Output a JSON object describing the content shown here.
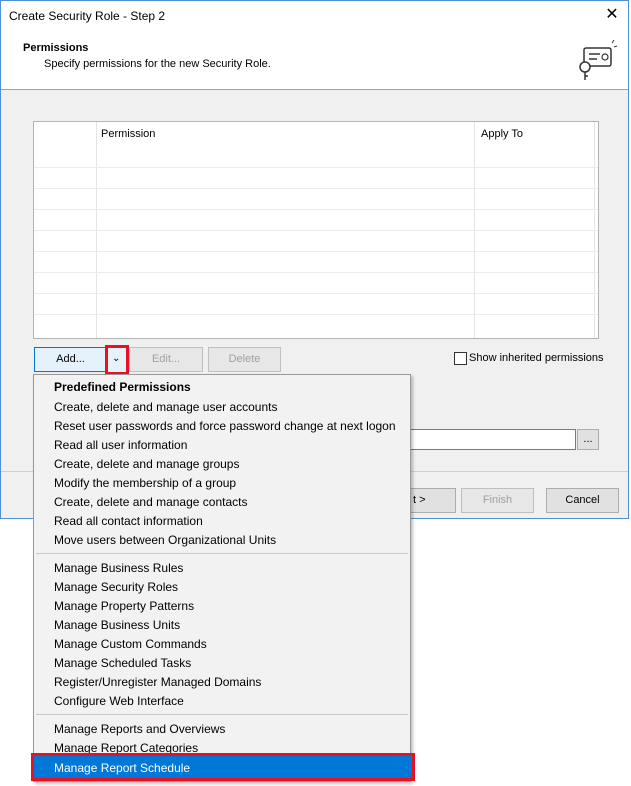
{
  "window": {
    "title": "Create Security Role - Step 2"
  },
  "header": {
    "title": "Permissions",
    "subtitle": "Specify permissions for the new Security Role."
  },
  "grid": {
    "columns": [
      "",
      "Permission",
      "Apply To"
    ]
  },
  "buttons": {
    "add": "Add...",
    "edit": "Edit...",
    "delete": "Delete",
    "next": "t >",
    "finish": "Finish",
    "cancel": "Cancel",
    "browse": "..."
  },
  "show_inherited_label": "Show inherited permissions",
  "menu": {
    "heading": "Predefined Permissions",
    "group1": [
      "Create, delete and manage user accounts",
      "Reset user passwords and force password change at next logon",
      "Read all user information",
      "Create, delete and manage groups",
      "Modify the membership of a group",
      "Create, delete and manage contacts",
      "Read all contact information",
      "Move users between Organizational Units"
    ],
    "group2": [
      "Manage Business Rules",
      "Manage Security Roles",
      "Manage Property Patterns",
      "Manage Business Units",
      "Manage Custom Commands",
      "Manage Scheduled Tasks",
      "Register/Unregister Managed Domains",
      "Configure Web Interface"
    ],
    "group3": [
      "Manage Reports and Overviews",
      "Manage Report Categories",
      "Manage Report Schedule"
    ]
  },
  "colors": {
    "accent": "#0078d7",
    "highlight_border": "#e81123"
  }
}
